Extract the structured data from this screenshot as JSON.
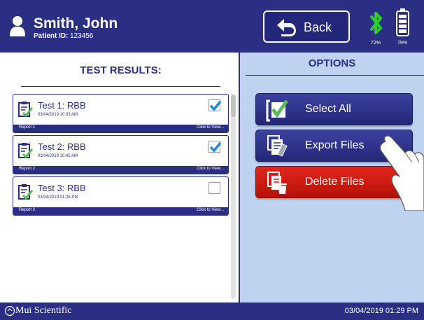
{
  "header": {
    "patient_name": "Smith, John",
    "patient_id_label": "Patient ID:",
    "patient_id_value": "123456",
    "back_label": "Back",
    "bluetooth_pct": "72%",
    "battery_pct": "79%",
    "bluetooth_icon": "bluetooth-icon",
    "battery_icon": "battery-icon"
  },
  "results": {
    "title": "TEST RESULTS:",
    "items": [
      {
        "title": "Test 1: RBB",
        "date": "03/04/2019 10:33 AM",
        "report": "Report 1",
        "view": "Click to View...",
        "checked": true
      },
      {
        "title": "Test 2: RBB",
        "date": "03/04/2019 10:42 AM",
        "report": "Report 2",
        "view": "Click to View...",
        "checked": true
      },
      {
        "title": "Test 3: RBB",
        "date": "03/04/2019 01:26 PM",
        "report": "Report 3",
        "view": "Click to View...",
        "checked": false
      }
    ]
  },
  "options": {
    "title": "OPTIONS",
    "select_all": "Select All",
    "export": "Export Files",
    "delete": "Delete Files"
  },
  "footer": {
    "company": "Mui Scientific",
    "datetime": "03/04/2019 01:29 PM"
  },
  "colors": {
    "primary": "#2b2f84",
    "options_bg": "#bfd3f1",
    "delete": "#d51a10",
    "bluetooth": "#2ecc2e",
    "check": "#1e88e5"
  }
}
